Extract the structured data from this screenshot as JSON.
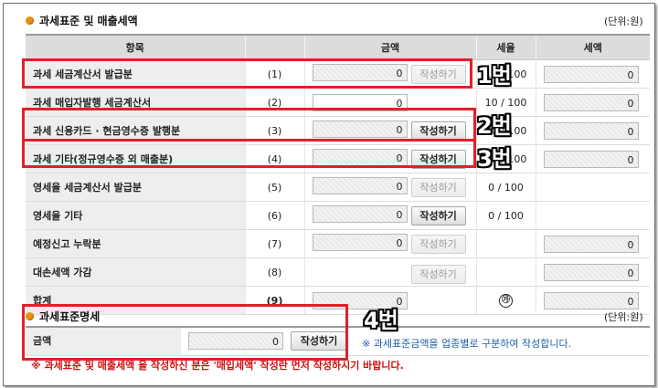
{
  "section1": {
    "title": "과세표준 및 매출세액",
    "unit": "(단위:원)"
  },
  "headers": {
    "item": "항목",
    "amount": "금액",
    "rate": "세율",
    "tax": "세액"
  },
  "rows": [
    {
      "label": "과세 세금계산서 발급분",
      "no": "(1)",
      "amount": "0",
      "button": "작성하기",
      "button_enabled": false,
      "rate": "10 / 100",
      "tax": "0"
    },
    {
      "label": "과세 매입자발행 세금계산서",
      "no": "(2)",
      "amount": "0",
      "button": "",
      "rate": "10 / 100",
      "tax": "0"
    },
    {
      "label": "과세 신용카드 · 현금영수증 발행분",
      "no": "(3)",
      "amount": "0",
      "button": "작성하기",
      "button_enabled": true,
      "rate": "10 / 100",
      "tax": "0"
    },
    {
      "label": "과세 기타(정규영수증 외 매출분)",
      "no": "(4)",
      "amount": "0",
      "button": "작성하기",
      "button_enabled": true,
      "rate": "10 / 100",
      "tax": "0"
    },
    {
      "label": "영세율 세금계산서 발급분",
      "no": "(5)",
      "amount": "0",
      "button": "작성하기",
      "button_enabled": false,
      "rate": "0 / 100",
      "tax": ""
    },
    {
      "label": "영세율 기타",
      "no": "(6)",
      "amount": "0",
      "button": "작성하기",
      "button_enabled": true,
      "rate": "0 / 100",
      "tax": ""
    },
    {
      "label": "예정신고 누락분",
      "no": "(7)",
      "amount": "0",
      "button": "작성하기",
      "button_enabled": false,
      "rate": "",
      "tax": "0"
    },
    {
      "label": "대손세액 가감",
      "no": "(8)",
      "amount": "",
      "button": "작성하기",
      "button_enabled": false,
      "rate": "",
      "tax": "0"
    },
    {
      "label": "합계",
      "no": "(9)",
      "amount": "0",
      "button": "",
      "rate": "㉮",
      "tax": "0"
    }
  ],
  "section2": {
    "title": "과세표준명세",
    "unit": "(단위:원)",
    "amount_label": "금액",
    "amount_value": "0",
    "button": "작성하기",
    "note": "※ 과세표준금액을 업종별로 구분하여 작성합니다."
  },
  "warning": "※  과세표준 및 매출세액 을 작성하신 분은 '매입세액' 작성란 먼저 작성하시기 바랍니다.",
  "annotations": {
    "tag1": "1번",
    "tag2": "2번",
    "tag3": "3번",
    "tag4": "4번",
    "color": "#e0202a"
  }
}
